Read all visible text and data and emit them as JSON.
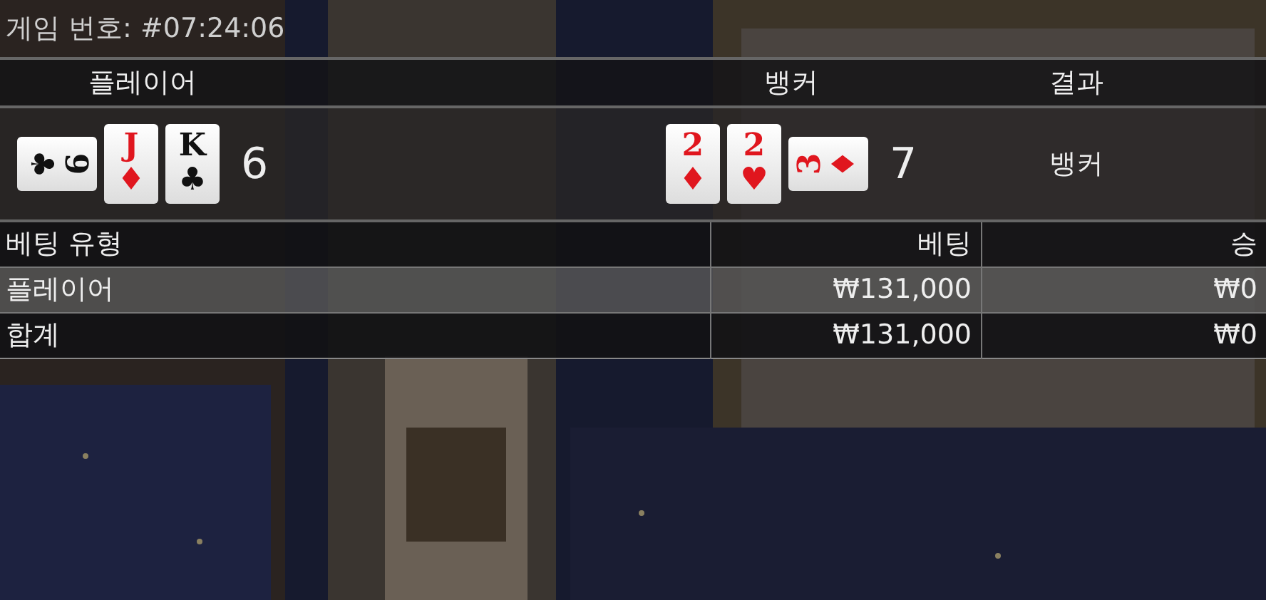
{
  "game_number": "게임 번호: #07:24:06",
  "result_headers": [
    "플레이어",
    "뱅커",
    "결과"
  ],
  "player": {
    "cards": [
      {
        "rank": "9",
        "suit": "♣",
        "red": false,
        "kind": "clockwise"
      },
      {
        "rank": "J",
        "suit": "♦",
        "red": true,
        "kind": "upright"
      },
      {
        "rank": "K",
        "suit": "♣",
        "red": false,
        "kind": "upright"
      }
    ],
    "score": "6"
  },
  "banker": {
    "cards": [
      {
        "rank": "2",
        "suit": "♦",
        "red": true,
        "kind": "upright"
      },
      {
        "rank": "2",
        "suit": "♥",
        "red": true,
        "kind": "upright"
      },
      {
        "rank": "3",
        "suit": "♦",
        "red": true,
        "kind": "counterclockwise"
      }
    ],
    "score": "7"
  },
  "result": "뱅커",
  "bets_table": {
    "columns": [
      "베팅 유형",
      "베팅",
      "승"
    ],
    "rows": [
      {
        "cells": [
          "플레이어",
          "₩131,000",
          "₩0"
        ],
        "highlighted": true
      },
      {
        "cells": [
          "합계",
          "₩131,000",
          "₩0"
        ],
        "highlighted": false
      }
    ]
  }
}
